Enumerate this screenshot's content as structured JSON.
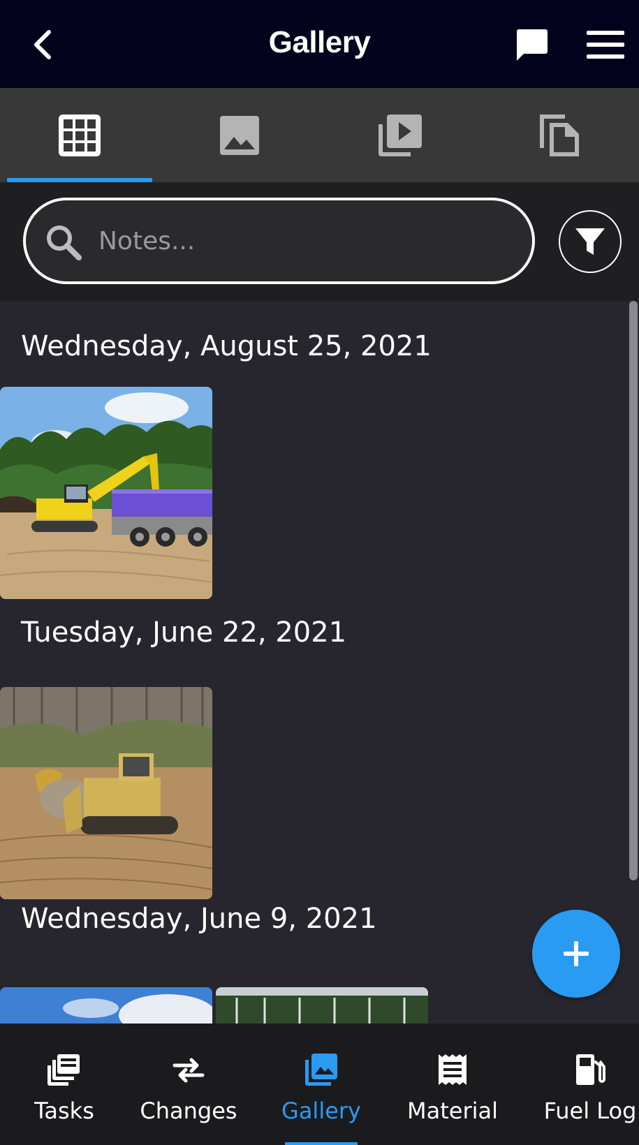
{
  "header": {
    "title": "Gallery",
    "back_icon": "chevron-left-icon",
    "chat_icon": "chat-bubble-icon",
    "menu_icon": "hamburger-menu-icon"
  },
  "media_tabs": [
    {
      "icon": "grid-icon",
      "active": true
    },
    {
      "icon": "image-icon",
      "active": false
    },
    {
      "icon": "video-library-icon",
      "active": false
    },
    {
      "icon": "documents-icon",
      "active": false
    }
  ],
  "search": {
    "placeholder": "Notes...",
    "value": "",
    "icon": "search-icon",
    "filter_icon": "filter-icon"
  },
  "gallery": {
    "groups": [
      {
        "date": "Wednesday, August 25, 2021",
        "photos": [
          "excavator and dump truck"
        ]
      },
      {
        "date": "Tuesday, June 22, 2021",
        "photos": [
          "bulldozers moving earth"
        ]
      },
      {
        "date": "Wednesday, June 9, 2021",
        "photos": [
          "sky",
          "tree line"
        ]
      }
    ]
  },
  "fab": {
    "icon": "plus-icon"
  },
  "bottom_nav": {
    "items": [
      {
        "label": "Tasks",
        "icon": "tasks-icon",
        "active": false
      },
      {
        "label": "Changes",
        "icon": "swap-arrows-icon",
        "active": false
      },
      {
        "label": "Gallery",
        "icon": "photo-library-icon",
        "active": true
      },
      {
        "label": "Material",
        "icon": "receipt-icon",
        "active": false
      },
      {
        "label": "Fuel Log",
        "icon": "fuel-pump-icon",
        "active": false
      }
    ]
  },
  "colors": {
    "accent": "#2a9bf2",
    "header_bg": "#03021d",
    "content_bg": "#27262e",
    "tabs_bg": "#383838",
    "nav_bg": "#1b1b1e"
  }
}
